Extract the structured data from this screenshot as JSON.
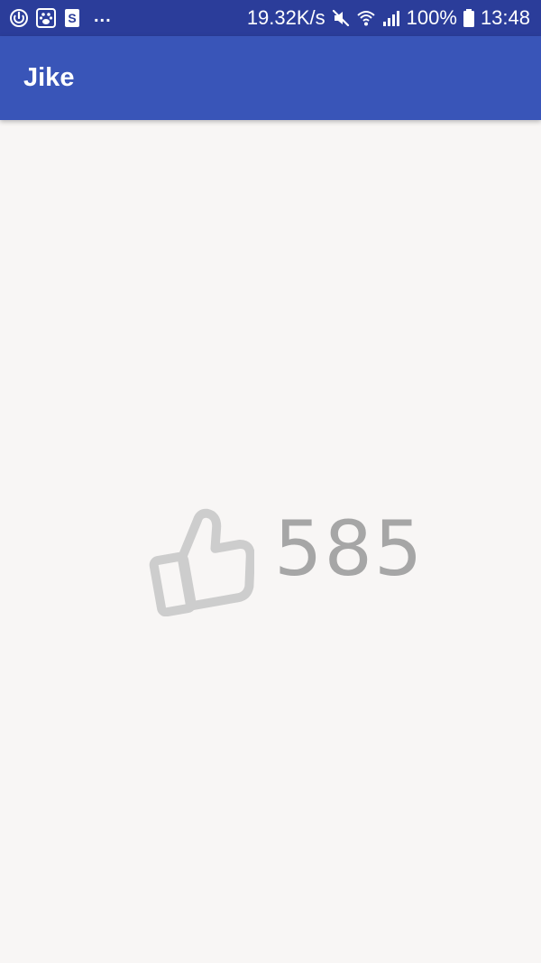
{
  "status_bar": {
    "network_speed": "19.32K/s",
    "battery_percent": "100%",
    "time": "13:48",
    "overflow_indicator": "...",
    "notification_icons": [
      "sync-icon",
      "paw-app-icon",
      "s-app-icon"
    ],
    "system_icons": [
      "mute-icon",
      "wifi-icon",
      "signal-icon",
      "battery-icon"
    ]
  },
  "app_bar": {
    "title": "Jike"
  },
  "like_widget": {
    "icon": "thumbs-up-icon",
    "count": "585"
  },
  "colors": {
    "status_bar": "#2b3d9a",
    "app_bar": "#3955b8",
    "background": "#f8f6f5",
    "like_gray": "#a6a6a6"
  }
}
